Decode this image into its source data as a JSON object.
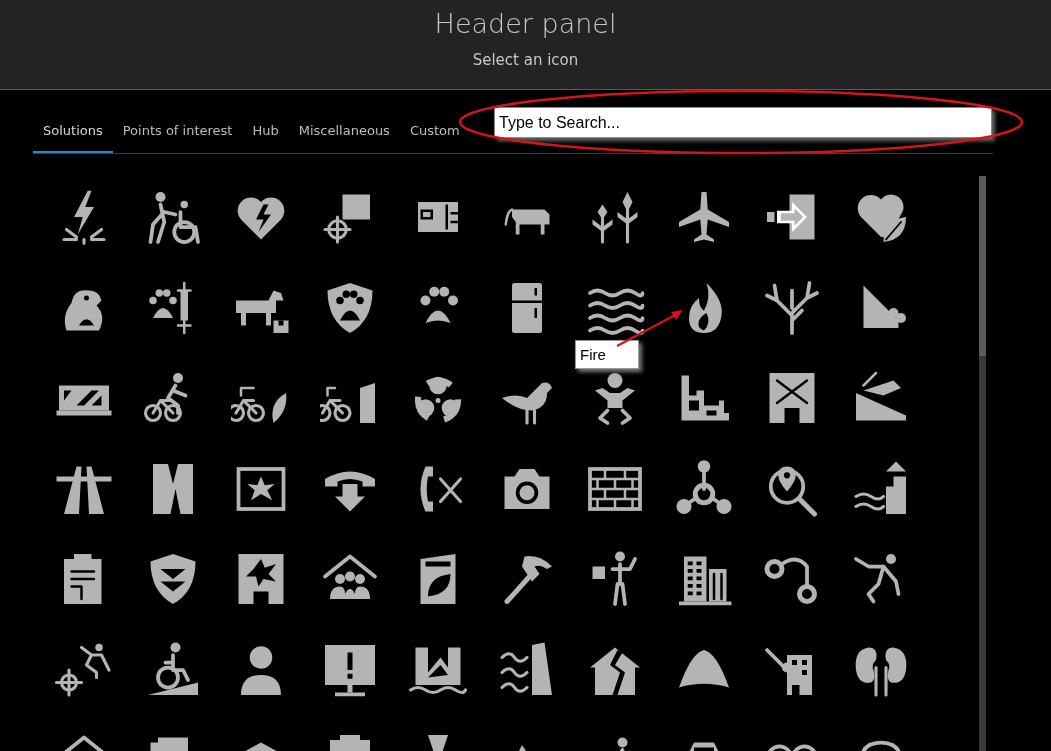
{
  "header": {
    "title": "Header panel",
    "subtitle": "Select an icon"
  },
  "tabs": [
    {
      "label": "Solutions",
      "selected": true
    },
    {
      "label": "Points of interest",
      "selected": false
    },
    {
      "label": "Hub",
      "selected": false
    },
    {
      "label": "Miscellaneous",
      "selected": false
    },
    {
      "label": "Custom",
      "selected": false
    }
  ],
  "search": {
    "placeholder": "Type to Search..."
  },
  "tooltip": {
    "text": "Fire"
  }
}
